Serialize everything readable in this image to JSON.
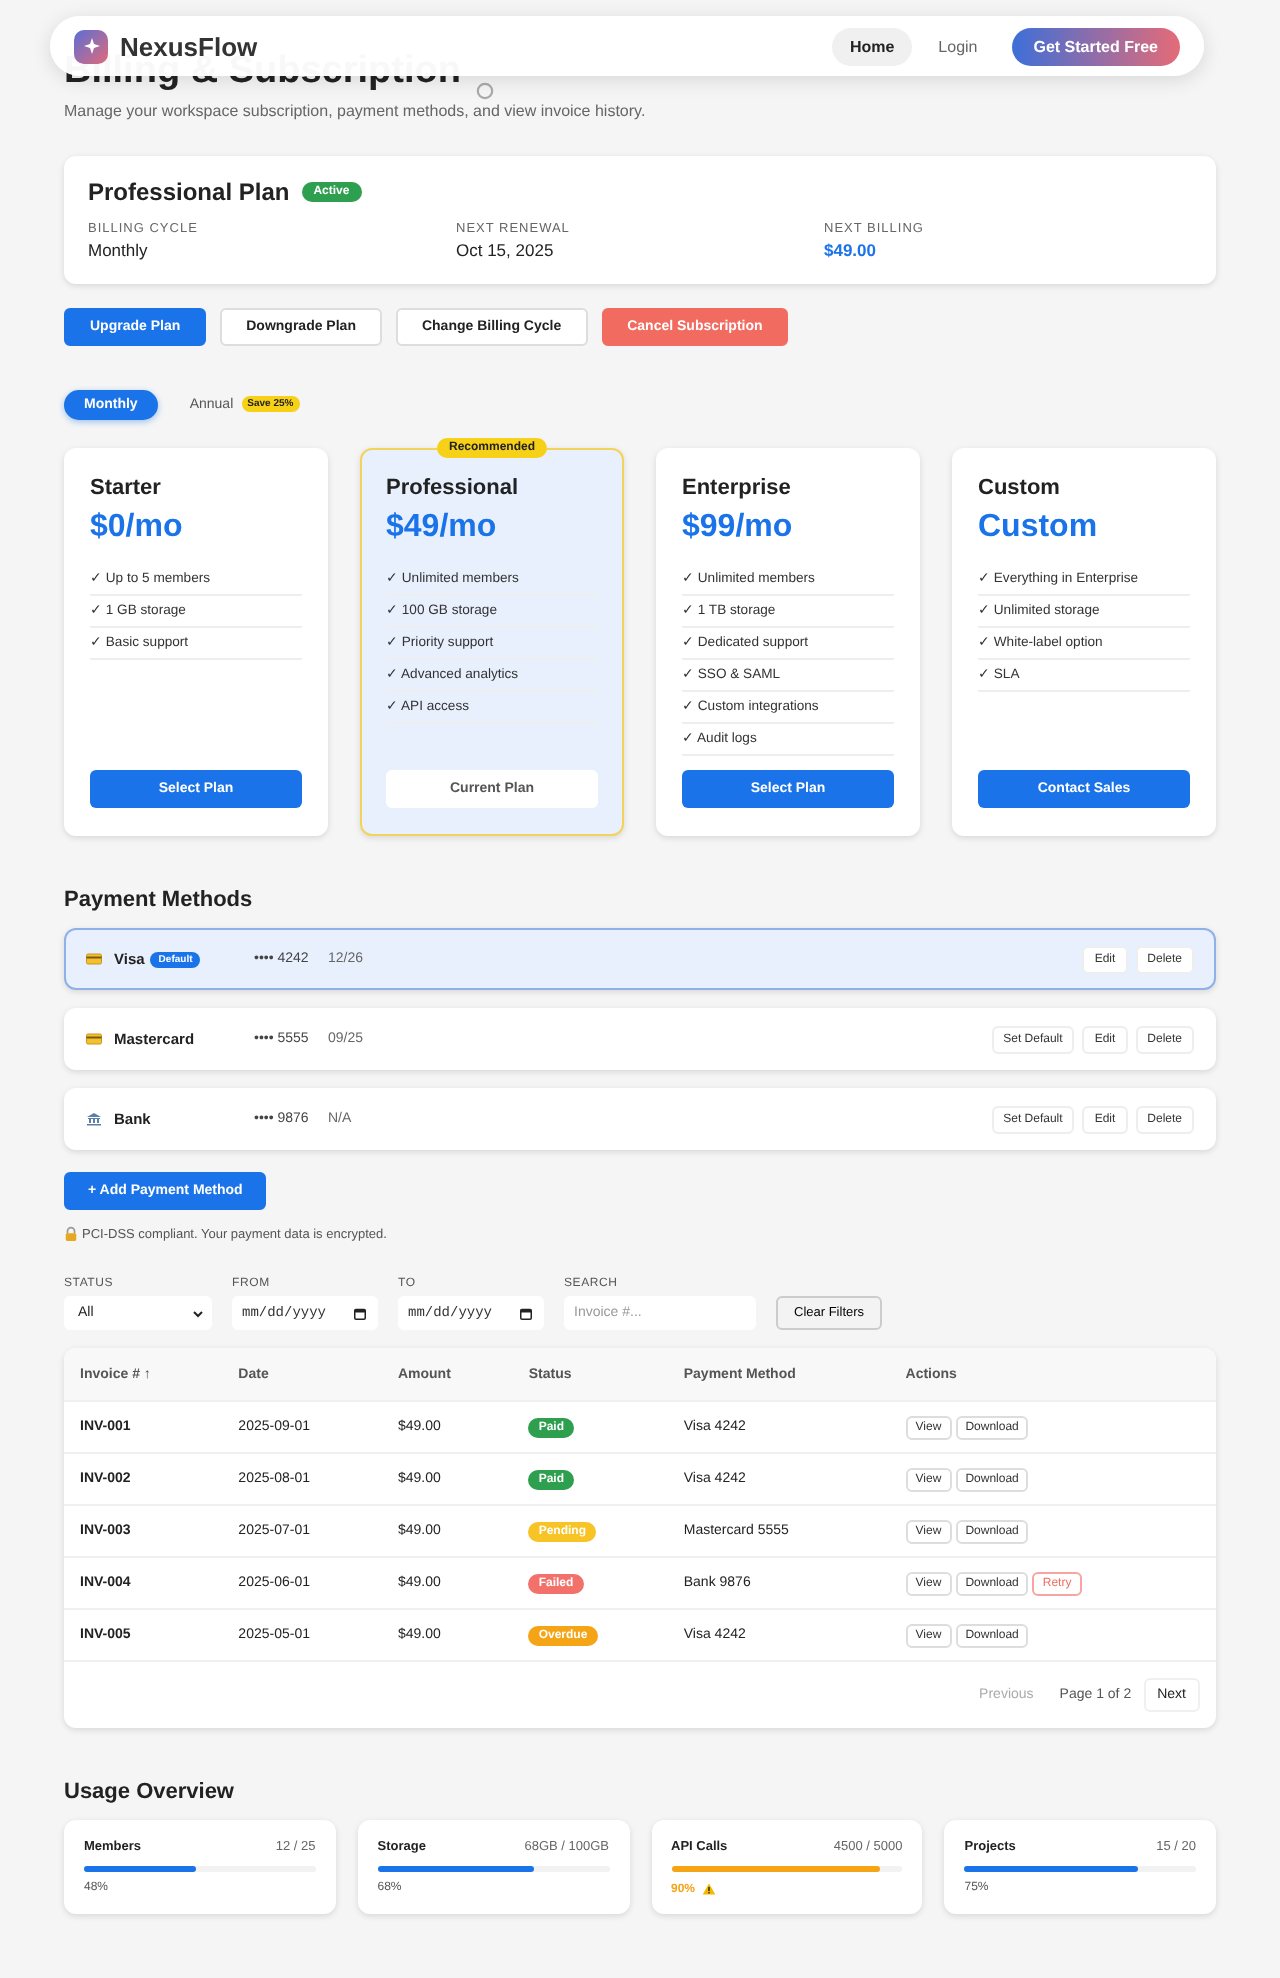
{
  "nav": {
    "brand": "NexusFlow",
    "links": [
      {
        "label": "Home",
        "selected": true
      },
      {
        "label": "Login",
        "selected": false
      }
    ],
    "cta": "Get Started Free"
  },
  "header": {
    "title": "Billing & Subscription",
    "subtitle": "Manage your workspace subscription, payment methods, and view invoice history."
  },
  "current_plan": {
    "name": "Professional Plan",
    "status": "Active",
    "fields": [
      {
        "label": "BILLING CYCLE",
        "value": "Monthly",
        "kind": "plain"
      },
      {
        "label": "NEXT RENEWAL",
        "value": "Oct 15, 2025",
        "kind": "plain"
      },
      {
        "label": "NEXT BILLING",
        "value": "$49.00",
        "kind": "amount"
      }
    ]
  },
  "plan_actions": [
    {
      "label": "Upgrade Plan",
      "kind": "primary"
    },
    {
      "label": "Downgrade Plan",
      "kind": "secondary"
    },
    {
      "label": "Change Billing Cycle",
      "kind": "secondary"
    },
    {
      "label": "Cancel Subscription",
      "kind": "danger"
    }
  ],
  "billing_toggle": [
    {
      "label": "Monthly",
      "selected": true
    },
    {
      "label": "Annual",
      "selected": false,
      "badge": "Save 25%"
    }
  ],
  "plans": [
    {
      "name": "Starter",
      "price": "$0/mo",
      "selected": false,
      "features": [
        "✓ Up to 5 members",
        "✓ 1 GB storage",
        "✓ Basic support"
      ],
      "button": "Select Plan"
    },
    {
      "name": "Professional",
      "price": "$49/mo",
      "selected": true,
      "ribbon": "Recommended",
      "features": [
        "✓ Unlimited members",
        "✓ 100 GB storage",
        "✓ Priority support",
        "✓ Advanced analytics",
        "✓ API access"
      ],
      "button": "Current Plan"
    },
    {
      "name": "Enterprise",
      "price": "$99/mo",
      "selected": false,
      "features": [
        "✓ Unlimited members",
        "✓ 1 TB storage",
        "✓ Dedicated support",
        "✓ SSO & SAML",
        "✓ Custom integrations",
        "✓ Audit logs"
      ],
      "button": "Select Plan"
    },
    {
      "name": "Custom",
      "price": "Custom",
      "selected": false,
      "features": [
        "✓ Everything in Enterprise",
        "✓ Unlimited storage",
        "✓ White-label option",
        "✓ SLA"
      ],
      "button": "Contact Sales"
    }
  ],
  "payment_methods": {
    "title": "Payment Methods",
    "items": [
      {
        "kind": "card",
        "name": "Visa",
        "selected": true,
        "badge": "Default",
        "number": "•••• 4242",
        "expiry": "12/26",
        "actions": [
          "Edit",
          "Delete"
        ]
      },
      {
        "kind": "card",
        "name": "Mastercard",
        "selected": false,
        "number": "•••• 5555",
        "expiry": "09/25",
        "actions": [
          "Set Default",
          "Edit",
          "Delete"
        ]
      },
      {
        "kind": "bank",
        "name": "Bank",
        "selected": false,
        "number": "•••• 9876",
        "expiry": "N/A",
        "actions": [
          "Set Default",
          "Edit",
          "Delete"
        ]
      }
    ],
    "add_button": "+ Add Payment Method",
    "note": "PCI-DSS compliant. Your payment data is encrypted."
  },
  "filters": {
    "status": {
      "label": "STATUS",
      "value": "All"
    },
    "from": {
      "label": "FROM",
      "placeholder": "mm/dd/yyyy"
    },
    "to": {
      "label": "TO",
      "placeholder": "mm/dd/yyyy"
    },
    "search": {
      "label": "SEARCH",
      "placeholder": "Invoice #..."
    },
    "clear": "Clear Filters"
  },
  "invoices": {
    "columns": [
      "Invoice # ↑",
      "Date",
      "Amount",
      "Status",
      "Payment Method",
      "Actions"
    ],
    "rows": [
      {
        "invoice": "INV-001",
        "date": "2025-09-01",
        "amount": "$49.00",
        "status": "Paid",
        "color": "#2e9e4f",
        "method": "Visa 4242",
        "actions": [
          {
            "label": "View",
            "kind": "normal"
          },
          {
            "label": "Download",
            "kind": "normal"
          }
        ]
      },
      {
        "invoice": "INV-002",
        "date": "2025-08-01",
        "amount": "$49.00",
        "status": "Paid",
        "color": "#2e9e4f",
        "method": "Visa 4242",
        "actions": [
          {
            "label": "View",
            "kind": "normal"
          },
          {
            "label": "Download",
            "kind": "normal"
          }
        ]
      },
      {
        "invoice": "INV-003",
        "date": "2025-07-01",
        "amount": "$49.00",
        "status": "Pending",
        "color": "#f7c325",
        "method": "Mastercard 5555",
        "actions": [
          {
            "label": "View",
            "kind": "normal"
          },
          {
            "label": "Download",
            "kind": "normal"
          }
        ]
      },
      {
        "invoice": "INV-004",
        "date": "2025-06-01",
        "amount": "$49.00",
        "status": "Failed",
        "color": "#f2726b",
        "method": "Bank 9876",
        "actions": [
          {
            "label": "View",
            "kind": "normal"
          },
          {
            "label": "Download",
            "kind": "normal"
          },
          {
            "label": "Retry",
            "kind": "danger"
          }
        ]
      },
      {
        "invoice": "INV-005",
        "date": "2025-05-01",
        "amount": "$49.00",
        "status": "Overdue",
        "color": "#f5a416",
        "method": "Visa 4242",
        "actions": [
          {
            "label": "View",
            "kind": "normal"
          },
          {
            "label": "Download",
            "kind": "normal"
          }
        ]
      }
    ],
    "pagination": {
      "previous": {
        "label": "Previous",
        "disabled": true
      },
      "page": "Page 1 of 2",
      "next": {
        "label": "Next",
        "disabled": false
      }
    }
  },
  "usage": {
    "title": "Usage Overview",
    "items": [
      {
        "name": "Members",
        "count": "12 / 25",
        "level": 0.48,
        "percent": "48%",
        "warning": false
      },
      {
        "name": "Storage",
        "count": "68GB / 100GB",
        "level": 0.68,
        "percent": "68%",
        "warning": false
      },
      {
        "name": "API Calls",
        "count": "4500 / 5000",
        "level": 0.9,
        "percent": "90%",
        "warning": true
      },
      {
        "name": "Projects",
        "count": "15 / 20",
        "level": 0.75,
        "percent": "75%",
        "warning": false
      }
    ]
  }
}
